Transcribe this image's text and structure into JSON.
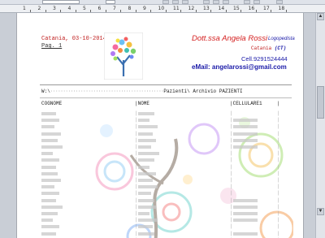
{
  "toolbar": {
    "font_field": "Courier New",
    "size_field": "10"
  },
  "ruler": {
    "numbers": [
      "1",
      "2",
      "3",
      "4",
      "5",
      "6",
      "7",
      "8",
      "9",
      "10",
      "11",
      "12",
      "13",
      "14",
      "15",
      "16",
      "17",
      "18"
    ]
  },
  "header": {
    "date_line": "Catania, 03-10-2014",
    "page_label": "Pag. 1",
    "doctor_name": "Dott.ssa Angela Rossi",
    "doctor_role": "Logopedista",
    "city": "Catania",
    "province": "(CT)",
    "cell": "Cell.9291524444",
    "email": "eMail: angelarossi@gmail.com"
  },
  "path": {
    "prefix": "W:\\",
    "hidden": "·············································",
    "suffix": "Pazienti\\ Archivio PAZIENTI"
  },
  "table": {
    "columns": [
      "COGNOME",
      "|NOME",
      "|CELLULARE1",
      "|"
    ]
  }
}
